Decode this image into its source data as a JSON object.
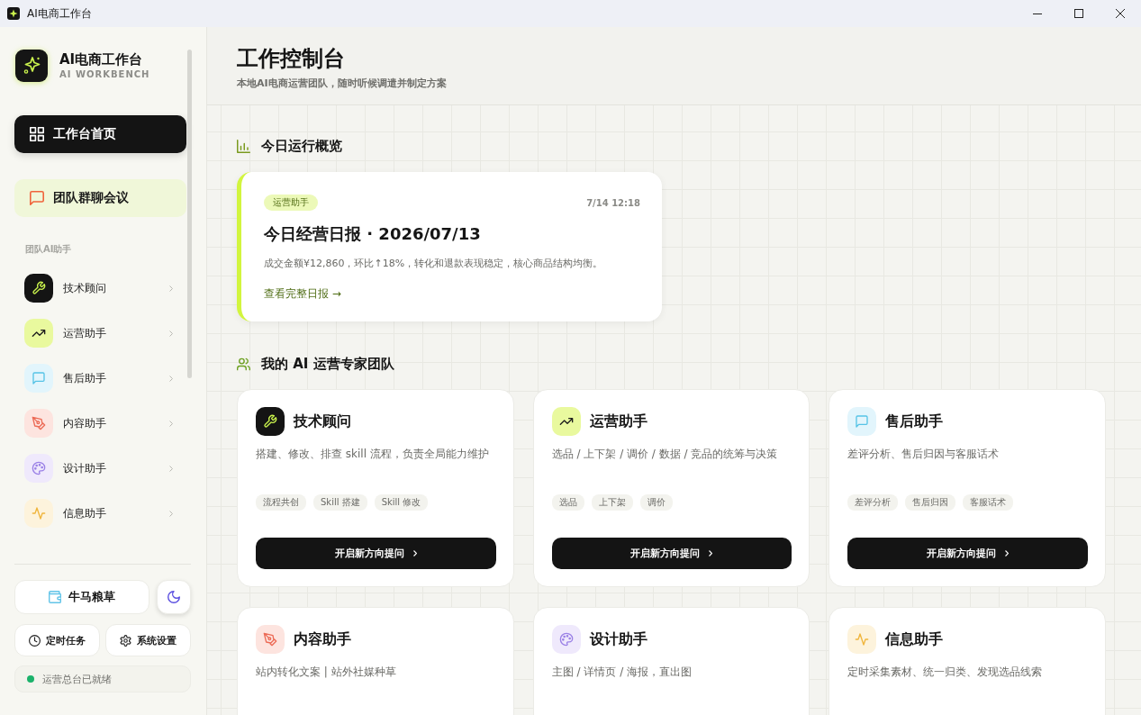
{
  "window": {
    "title": "AI电商工作台"
  },
  "sidebar": {
    "brand": {
      "title": "AI电商工作台",
      "subtitle": "AI WORKBENCH"
    },
    "nav": [
      {
        "label": "工作台首页",
        "kind": "grid",
        "selected": true
      },
      {
        "label": "团队群聊会议",
        "kind": "chat",
        "selected": false
      }
    ],
    "section_label": "团队AI助手",
    "assistants": [
      {
        "name": "技术顾问",
        "kind": "wrench"
      },
      {
        "name": "运营助手",
        "kind": "trend"
      },
      {
        "name": "售后助手",
        "kind": "chat"
      },
      {
        "name": "内容助手",
        "kind": "pen"
      },
      {
        "name": "设计助手",
        "kind": "palette"
      },
      {
        "name": "信息助手",
        "kind": "pulse"
      }
    ],
    "supplies_button": "牛马粮草",
    "actions": [
      {
        "label": "定时任务",
        "kind": "clock"
      },
      {
        "label": "系统设置",
        "kind": "gear"
      }
    ],
    "status": {
      "text": "运营总台已就绪",
      "ready": true
    }
  },
  "header": {
    "title": "工作控制台",
    "subtitle": "本地AI电商运营团队，随时听候调遣并制定方案"
  },
  "overview": {
    "heading": "今日运行概览",
    "report": {
      "tag": "运营助手",
      "time": "7/14 12:18",
      "title": "今日经营日报 · 2026/07/13",
      "summary": "成交金额¥12,860，环比↑18%，转化和退款表现稳定，核心商品结构均衡。",
      "link": "查看完整日报 →"
    }
  },
  "team": {
    "heading": "我的 AI 运营专家团队",
    "cards": [
      {
        "name": "技术顾问",
        "kind": "wrench",
        "description": "搭建、修改、排查 skill 流程，负责全局能力维护",
        "tags": [
          "流程共创",
          "Skill 搭建",
          "Skill 修改"
        ],
        "button": "开启新方向提问"
      },
      {
        "name": "运营助手",
        "kind": "trend",
        "description": "选品 / 上下架 / 调价 / 数据 / 竞品的统筹与决策",
        "tags": [
          "选品",
          "上下架",
          "调价"
        ],
        "button": "开启新方向提问"
      },
      {
        "name": "售后助手",
        "kind": "chat",
        "description": "差评分析、售后归因与客服话术",
        "tags": [
          "差评分析",
          "售后归因",
          "客服话术"
        ],
        "button": "开启新方向提问"
      },
      {
        "name": "内容助手",
        "kind": "pen",
        "description": "站内转化文案 | 站外社媒种草"
      },
      {
        "name": "设计助手",
        "kind": "palette",
        "description": "主图 / 详情页 / 海报，直出图"
      },
      {
        "name": "信息助手",
        "kind": "pulse",
        "description": "定时采集素材、统一归类、发现选品线索"
      }
    ]
  }
}
